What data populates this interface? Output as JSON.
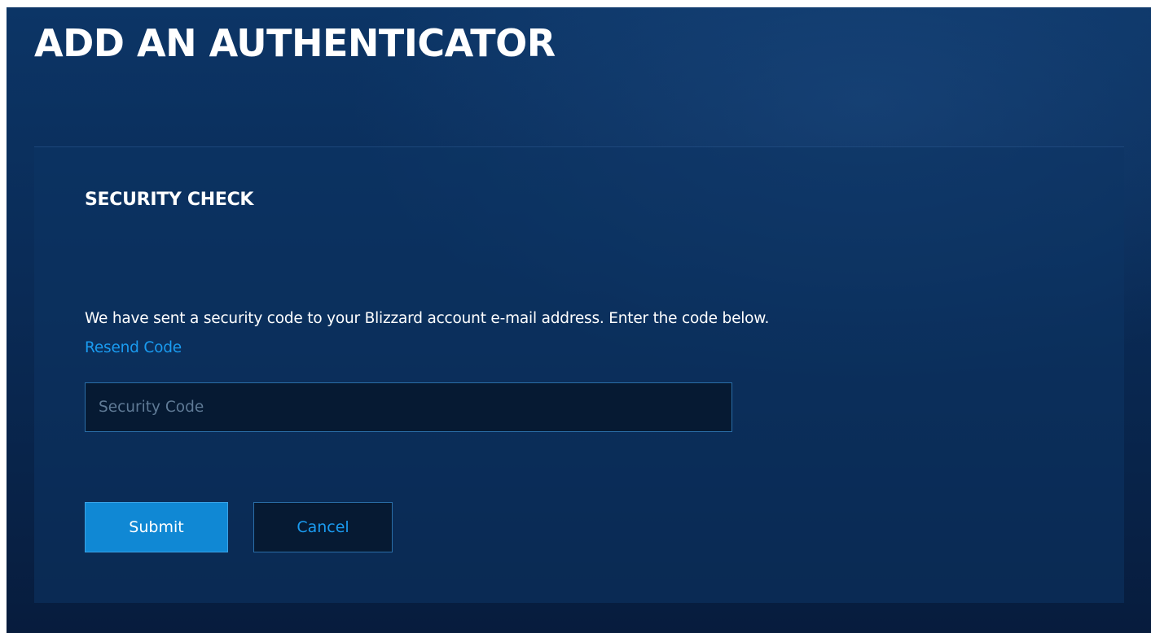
{
  "page": {
    "title": "ADD AN AUTHENTICATOR"
  },
  "security_check": {
    "heading": "SECURITY CHECK",
    "instructions": "We have sent a security code to your Blizzard account e-mail address. Enter the code below.",
    "resend_label": "Resend Code",
    "code_input": {
      "value": "",
      "placeholder": "Security Code"
    },
    "submit_label": "Submit",
    "cancel_label": "Cancel"
  },
  "colors": {
    "background": "#0a2c58",
    "link": "#1a9bf0",
    "primary_button": "#1088d4",
    "input_background": "#061a33",
    "input_border": "#2a6ea8"
  }
}
